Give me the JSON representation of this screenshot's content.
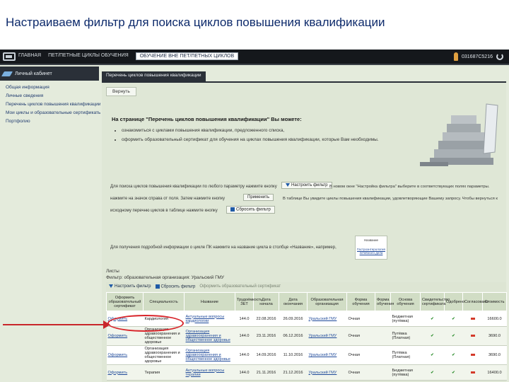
{
  "slide": {
    "title": "Настраиваем фильтр для поиска циклов повышения квалификации"
  },
  "topbar": {
    "nav": [
      "ГЛАВНАЯ",
      "ПЕТ/ПЕТНЫЕ ЦИКЛЫ ОБУЧЕНИЯ",
      "ОБУЧЕНИЕ ВНЕ ПЕТ/ПЕТНЫХ ЦИКЛОВ"
    ],
    "user_id": "031687С5216"
  },
  "sidebar": {
    "header": "Личный кабинет",
    "items": [
      "Общая информация",
      "Личные сведения",
      "Перечень циклов повышения квалификации",
      "Мои циклы и образовательные сертификаты",
      "Портфолио"
    ]
  },
  "main": {
    "tab": "Перечень циклов повышения квалификации",
    "back_button": "Вернуть",
    "intro_title": "На странице \"Перечень циклов повышения квалификации\" Вы можете:",
    "intro_items": [
      "ознакомиться с циклами повышения квалификации, предложенного списка,",
      "оформить образовательный сертификат для обучения на циклах повышения квалификации, которые Вам необходимы."
    ],
    "instr1": "Для поиска циклов повышения квалификации по любого параметру нажмите кнопку",
    "filter_button": "Настроить фильтр",
    "instr1b": "В новом окне \"Настройка фильтра\" выберите в соответствующих полях параметры.",
    "instr2": "нажмите на значок      справа от поля. Затем нажмите кнопку",
    "apply_button": "Применить",
    "instr2b": "В таблице Вы увидите циклы повышения квалификации, удовлетворяющие Вашему запросу. Чтобы вернуться к",
    "instr3": "исходному перечню циклов в таблице нажмите кнопку",
    "reset_button": "Сбросить фильтр",
    "instr4": "Для получения подробной информации о цикле ПК нажмите на название цикла в столбце «Название», например,",
    "mini_card_title": "Название",
    "mini_card_link": "Гастроэнтерология лечебного дела",
    "list_label": "Листы",
    "filter_label": "Фильтр: образовательная организация: Уральский  ГМУ",
    "filter_bar": {
      "set_filter": "Настроить фильтр",
      "reset": "Сбросить фильтр",
      "cert": "Оформить образовательный сертификат"
    }
  },
  "table": {
    "headers": [
      "Оформить образовательный сертификат",
      "Специальность",
      "Название",
      "Трудоёмкость ЗЕТ",
      "Дата начала",
      "Дата окончания",
      "Образовательная организация",
      "Форма обучения",
      "Форма обучения",
      "Основа обучения",
      "Свидетельство сертификата",
      "Одобрено",
      "Согласовано",
      "Стоимость"
    ],
    "rows": [
      [
        "Оформить",
        "Кардиология",
        "Актуальные вопросы кардиологии",
        "144.0",
        "22.08.2016",
        "26.09.2016",
        "Уральский ГМУ",
        "Очная",
        "",
        "Бюджетная (путёвка)",
        "✔",
        "✔",
        "—",
        "16600.0"
      ],
      [
        "Оформить",
        "Организация здравоохранения и общественное здоровье",
        "Организация здравоохранения и общественное здоровье",
        "144.0",
        "23.11.2016",
        "06.12.2016",
        "Уральский ГМУ",
        "Очная",
        "",
        "Путёвка (Платная)",
        "✔",
        "✔",
        "—",
        "3690.0"
      ],
      [
        "Оформить",
        "Организация здравоохранения и общественное здоровье",
        "Организация здравоохранения и общественное здоровье",
        "144.0",
        "14.09.2016",
        "11.10.2016",
        "Уральский ГМУ",
        "Очная",
        "",
        "Путёвка (Платная)",
        "✔",
        "✔",
        "—",
        "3690.0"
      ],
      [
        "Оформить",
        "Терапия",
        "Актуальные вопросы терапии",
        "144.0",
        "21.11.2016",
        "21.12.2016",
        "Уральский ГМУ",
        "Очная",
        "",
        "Бюджетная (путёвка)",
        "✔",
        "✔",
        "—",
        "16400.0"
      ]
    ]
  },
  "colors": {
    "highlight": "#d8242a",
    "brand_dark": "#2a3038",
    "panel": "#dfe7d6"
  }
}
